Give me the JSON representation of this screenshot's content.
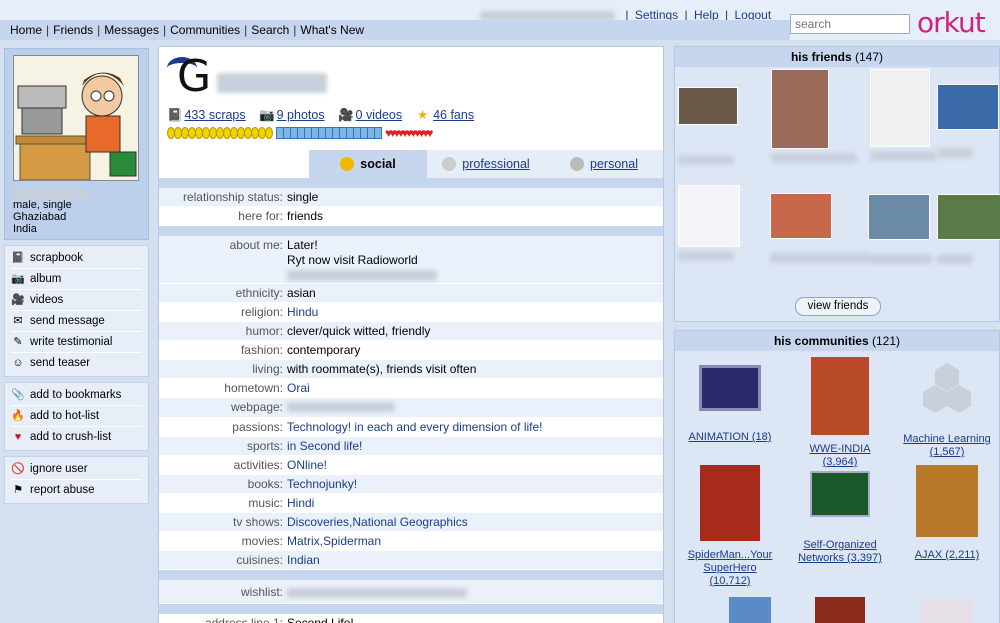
{
  "topnav": {
    "items": [
      "Home",
      "Friends",
      "Messages",
      "Communities",
      "Search",
      "What's New"
    ]
  },
  "toplinks": {
    "email_blurred": "editor@techcrunch.com",
    "settings": "Settings",
    "help": "Help",
    "logout": "Logout"
  },
  "search": {
    "placeholder": "search"
  },
  "logo": "orkut",
  "profile": {
    "info_line1": "male, single",
    "info_line2": "Ghaziabad",
    "info_line3": "India"
  },
  "menu": {
    "group1": [
      "scrapbook",
      "album",
      "videos",
      "send message",
      "write testimonial",
      "send teaser"
    ],
    "group2": [
      "add to bookmarks",
      "add to hot-list",
      "add to crush-list"
    ],
    "group3": [
      "ignore user",
      "report abuse"
    ]
  },
  "stats": {
    "scraps": "433 scraps",
    "photos": "9 photos",
    "videos": "0 videos",
    "fans": "46 fans"
  },
  "tabs": {
    "social": "social",
    "professional": "professional",
    "personal": "personal"
  },
  "details": {
    "g1": [
      {
        "k": "relationship status:",
        "v": "single"
      },
      {
        "k": "here for:",
        "v": "friends"
      }
    ],
    "about_key": "about me:",
    "about_l1": "Later!",
    "about_l2": "Ryt now visit Radioworld",
    "g2": [
      {
        "k": "ethnicity:",
        "v": "asian"
      },
      {
        "k": "religion:",
        "v": "Hindu"
      },
      {
        "k": "humor:",
        "v": "clever/quick witted, friendly"
      },
      {
        "k": "fashion:",
        "v": "contemporary"
      },
      {
        "k": "living:",
        "v": "with roommate(s), friends visit often"
      },
      {
        "k": "hometown:",
        "v": "Orai"
      },
      {
        "k": "webpage:",
        "v": ""
      },
      {
        "k": "passions:",
        "v": "Technology! in each and every dimension of life!"
      },
      {
        "k": "sports:",
        "v": "in Second life!"
      },
      {
        "k": "activities:",
        "v": "ONline!"
      },
      {
        "k": "books:",
        "v": "Technojunky!"
      },
      {
        "k": "music:",
        "v": "Hindi"
      },
      {
        "k": "tv shows:",
        "v": "Discoveries,National Geographics"
      },
      {
        "k": "movies:",
        "v": "Matrix,Spiderman"
      },
      {
        "k": "cuisines:",
        "v": "Indian"
      }
    ],
    "wishlist_key": "wishlist:",
    "address_key": "address line 1:",
    "address_val": "Second Life!"
  },
  "friends": {
    "title": "his friends",
    "count": "(147)",
    "view_button": "view friends"
  },
  "communities": {
    "title": "his communities",
    "count": "(121)",
    "items": [
      {
        "l1": "ANIMATION (18)",
        "l2": ""
      },
      {
        "l1": "WWE-INDIA",
        "l2": "(3,964)"
      },
      {
        "l1": "Machine Learning",
        "l2": "(1,567)"
      },
      {
        "l1": "SpiderMan...Your",
        "l2": "SuperHero",
        "l3": "(10,712)"
      },
      {
        "l1": "Self-Organized",
        "l2": "Networks (3,397)"
      },
      {
        "l1": "AJAX (2,211)",
        "l2": ""
      }
    ]
  },
  "colors": {
    "accent": "#d0217e",
    "link": "#1b3c8c",
    "panel": "#c5d6ee"
  }
}
